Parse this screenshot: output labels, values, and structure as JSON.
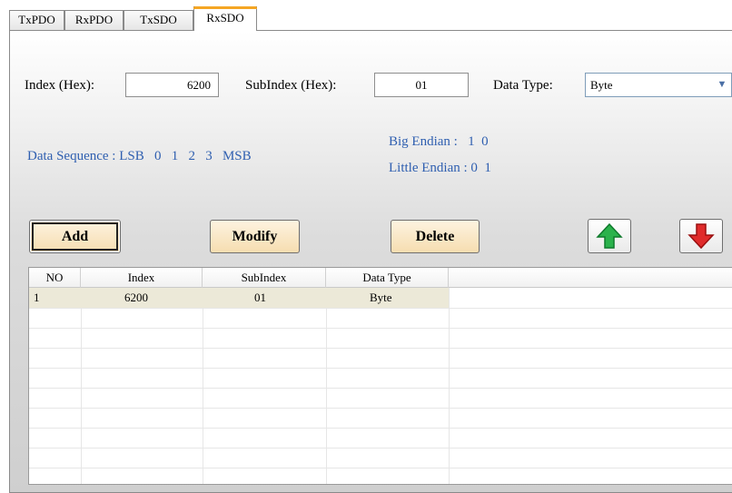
{
  "tabs": [
    "TxPDO",
    "RxPDO",
    "TxSDO",
    "RxSDO"
  ],
  "active_tab": "RxSDO",
  "form": {
    "index_label": "Index (Hex):",
    "index_value": "6200",
    "subindex_label": "SubIndex (Hex):",
    "subindex_value": "01",
    "datatype_label": "Data Type:",
    "datatype_value": "Byte"
  },
  "info": {
    "sequence": "Data Sequence : LSB   0   1   2   3   MSB",
    "big_endian": "Big Endian :   1  0",
    "little_endian": "Little Endian : 0  1"
  },
  "buttons": {
    "add": "Add",
    "modify": "Modify",
    "delete": "Delete"
  },
  "table": {
    "headers": [
      "NO",
      "Index",
      "SubIndex",
      "Data Type"
    ],
    "rows": [
      {
        "no": "1",
        "index": "6200",
        "subindex": "01",
        "datatype": "Byte"
      }
    ]
  },
  "colors": {
    "info_text": "#2f5fb0",
    "button_fill": "#f6ddb0",
    "up_arrow": "#2bb24c",
    "down_arrow": "#e02b2b",
    "active_tab_accent": "#f5a623"
  },
  "icons": {
    "up": "arrow-up-icon",
    "down": "arrow-down-icon",
    "dropdown": "chevron-down-icon"
  }
}
